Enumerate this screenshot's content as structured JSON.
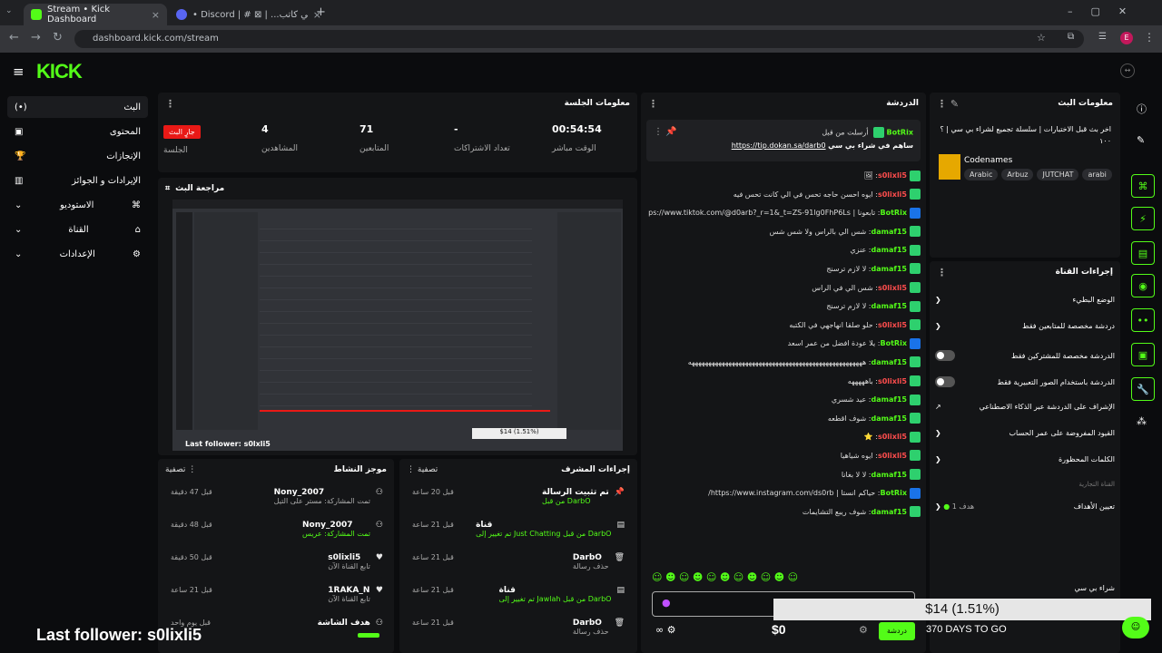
{
  "browser": {
    "tabs": [
      {
        "title": "Stream • Kick Dashboard",
        "active": true
      },
      {
        "title": "• Discord | # ⊠ | ...الشعبي كاتب",
        "active": false
      }
    ],
    "url": "dashboard.kick.com/stream"
  },
  "app": {
    "logo": "KICK"
  },
  "sidebar": {
    "items": [
      {
        "label": "البث",
        "icon": "live-icon"
      },
      {
        "label": "المحتوى",
        "icon": "content-icon"
      },
      {
        "label": "الإنجازات",
        "icon": "trophy-icon"
      },
      {
        "label": "الإيرادات و الجوائز",
        "icon": "chart-icon"
      },
      {
        "label": "الاستوديو",
        "icon": "studio-icon"
      },
      {
        "label": "القناة",
        "icon": "channel-icon"
      },
      {
        "label": "الإعدادات",
        "icon": "gear-icon"
      }
    ]
  },
  "session": {
    "title": "معلومات الجلسة",
    "live_badge": "جارٍ البث",
    "live_label": "الجلسة",
    "viewers": "4",
    "viewers_label": "المشاهدين",
    "followers": "71",
    "followers_label": "المتابعين",
    "subs": "-",
    "subs_label": "تعداد الاشتراكات",
    "uptime": "00:54:54",
    "uptime_label": "الوقت مباشر"
  },
  "preview": {
    "title": "مراجعة البث",
    "overlay_followers": "Last follower: s0lxli5",
    "overlay_price": "$14 (1.51%)"
  },
  "activity": {
    "title": "موجز النشاط",
    "filter": "تصفية",
    "items": [
      {
        "name": "Nony_2007",
        "desc": "تمت المشاركة: مستر على التيل",
        "time": "قبل 47 دقيقة",
        "icon": "users-icon"
      },
      {
        "name": "Nony_2007",
        "desc": "تمت المشاركة: عريس",
        "time": "قبل 48 دقيقة",
        "icon": "users-icon"
      },
      {
        "name": "s0lixli5",
        "desc": "تابع القناة الآن",
        "time": "قبل 50 دقيقة",
        "icon": "heart-icon"
      },
      {
        "name": "1RAKA_N",
        "desc": "تابع القناة الآن",
        "time": "قبل 21 ساعة",
        "icon": "heart-icon"
      },
      {
        "name": "هدف الشاشة",
        "desc": "",
        "time": "قبل يوم واحد",
        "icon": "users-icon"
      }
    ]
  },
  "modactions": {
    "title": "إجراءات المشرف",
    "filter": "تصفية",
    "items": [
      {
        "title": "تم تثبيت الرسالة",
        "desc": "من قبل DarbO",
        "time": "قبل 20 ساعة",
        "icon": "pin-icon"
      },
      {
        "title": "قناة",
        "desc": "تم تغيير إلى Just Chatting من قبل DarbO",
        "time": "قبل 21 ساعة",
        "icon": "category-icon"
      },
      {
        "title": "DarbO",
        "desc": "حذف رسالة",
        "time": "قبل 21 ساعة",
        "icon": "trash-icon"
      },
      {
        "title": "قناة",
        "desc": "تم تغيير إلى Jawlah من قبل DarbO",
        "time": "قبل 21 ساعة",
        "icon": "category-icon"
      },
      {
        "title": "DarbO",
        "desc": "حذف رسالة",
        "time": "قبل 21 ساعة",
        "icon": "trash-icon"
      }
    ]
  },
  "chat": {
    "title": "الدردشة",
    "pinned_user": "BotRix",
    "pinned_by": "أرسلت من قبل",
    "pinned_text": "ساهم في شراء بي سي",
    "pinned_link": "https://tip.dokan.sa/darb0",
    "messages": [
      {
        "user": "s0lixli5",
        "color": "r",
        "text": "🖼"
      },
      {
        "user": "s0lixli5",
        "color": "r",
        "text": "ايوه احسن حاجه تحس في الي كانت تحس فيه"
      },
      {
        "user": "BotRix",
        "color": "b",
        "text": "تابعونا | https://www.tiktok.com/@d0arb?_r=1&_t=ZS-91lg0FhP6Ls"
      },
      {
        "user": "damaf15",
        "color": "g",
        "text": "شس الي بالراس ولا شس شس"
      },
      {
        "user": "damaf15",
        "color": "g",
        "text": "عنزي"
      },
      {
        "user": "damaf15",
        "color": "g",
        "text": "لا لازم ترسنج"
      },
      {
        "user": "s0lixli5",
        "color": "r",
        "text": "شس الي في الراس"
      },
      {
        "user": "damaf15",
        "color": "g",
        "text": "لا لازم ترسنج"
      },
      {
        "user": "s0lixli5",
        "color": "r",
        "text": "حلو صلقا انهاجهي في الكتبه"
      },
      {
        "user": "BotRix",
        "color": "b",
        "text": "يلا عودة افضل من عمر اسعد"
      },
      {
        "user": "damaf15",
        "color": "g",
        "text": "ههههههههههههههههههههههههههههههههههههههههههههههههههههه"
      },
      {
        "user": "s0lixli5",
        "color": "r",
        "text": "باهههههه"
      },
      {
        "user": "damaf15",
        "color": "g",
        "text": "عيد شسري"
      },
      {
        "user": "damaf15",
        "color": "g",
        "text": "شوف اقطعه"
      },
      {
        "user": "s0lixli5",
        "color": "r",
        "text": "⭐"
      },
      {
        "user": "s0lixli5",
        "color": "r",
        "text": "ايوه شياهيا"
      },
      {
        "user": "damaf15",
        "color": "g",
        "text": "لا لا بغانا"
      },
      {
        "user": "BotRix",
        "color": "b",
        "text": "حياكم انستا | https://www.instagram.com/ds0rb/"
      },
      {
        "user": "damaf15",
        "color": "g",
        "text": "شوف ريبع التشايمات"
      }
    ],
    "send_label": "دردشة",
    "goal_amount": "$0",
    "goal_price": "$14 (1.51%)",
    "goal_days": "370 DAYS TO GO",
    "goal_title": "شراء بي سي"
  },
  "streaminfo": {
    "title": "معلومات البث",
    "stream_title": "اخر بث قبل الاختبارات | سلسلة تجميع لشراء بي سي | ؟ ١٠٠",
    "category": "Codenames",
    "tags": [
      "Arabic",
      "Arbuz",
      "JUTCHAT",
      "arabi"
    ]
  },
  "channelactions": {
    "title": "إجراءات القناة",
    "items": [
      {
        "label": "الوضع البطيء",
        "control": "chevron"
      },
      {
        "label": "دردشة مخصصة للمتابعين فقط",
        "control": "chevron"
      },
      {
        "label": "الدردشة مخصصة للمشتركين فقط",
        "control": "toggle"
      },
      {
        "label": "الدردشة باستخدام الصور التعبيرية فقط",
        "control": "toggle"
      },
      {
        "label": "الإشراف على الدردشة عبر الذكاء الاصطناعي",
        "control": "external"
      },
      {
        "label": "القيود المفروضة على عمر الحساب",
        "control": "chevron"
      },
      {
        "label": "الكلمات المحظورة",
        "control": "chevron"
      }
    ],
    "section_label": "القناة التجارية",
    "assign_label": "تعيين الأهداف",
    "assign_value": "هدف 1"
  },
  "overlay": {
    "last_follower": "Last follower: s0lixli5",
    "price_box": "$14 (1.51%)"
  }
}
